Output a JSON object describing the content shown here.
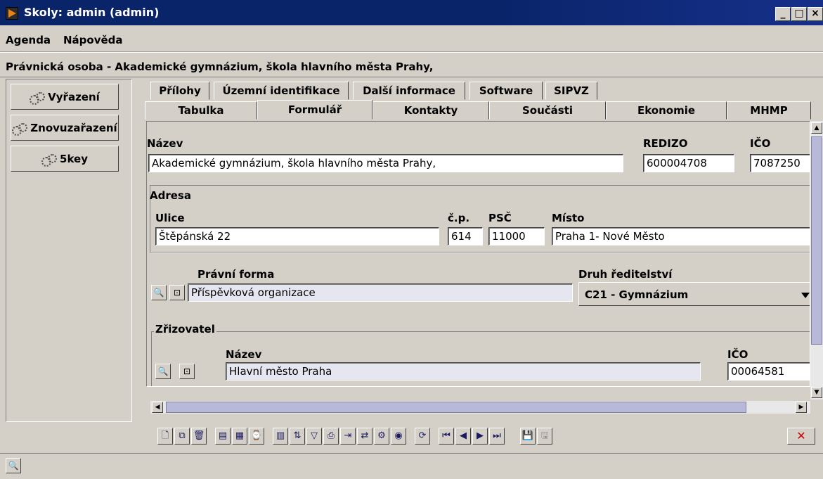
{
  "window": {
    "title": "Skoly: admin (admin)"
  },
  "menu": {
    "items": [
      "Agenda",
      "Nápověda"
    ]
  },
  "subject": {
    "text": "Právnická osoba - Akademické gymnázium, škola hlavního města Prahy,"
  },
  "left_buttons": [
    "Vyřazení",
    "Znovuzařazení",
    "5key"
  ],
  "tabs_top": [
    "Přílohy",
    "Územní identifikace",
    "Další informace",
    "Software",
    "SIPVZ"
  ],
  "tabs_bottom": [
    "Tabulka",
    "Formulář",
    "Kontakty",
    "Součásti",
    "Ekonomie",
    "MHMP"
  ],
  "active_tab": "Formulář",
  "form": {
    "nazev_label": "Název",
    "nazev_value": "Akademické gymnázium, škola hlavního města Prahy,",
    "redizo_label": "REDIZO",
    "redizo_value": "600004708",
    "ico_label": "IČO",
    "ico_value": "7087250",
    "adresa_legend": "Adresa",
    "ulice_label": "Ulice",
    "ulice_value": "Štěpánská 22",
    "cp_label": "č.p.",
    "cp_value": "614",
    "psc_label": "PSČ",
    "psc_value": "11000",
    "misto_label": "Místo",
    "misto_value": "Praha 1- Nové Město",
    "pravni_forma_label": "Právní forma",
    "pravni_forma_value": "Příspěvková organizace",
    "druh_label": "Druh ředitelství",
    "druh_value": "C21 - Gymnázium",
    "zrizovatel_legend": "Zřizovatel",
    "zr_nazev_label": "Název",
    "zr_nazev_value": "Hlavní město Praha",
    "zr_ico_label": "IČO",
    "zr_ico_value": "00064581"
  },
  "close_glyph": "✕",
  "colors": {
    "titlebar": "#0a246a",
    "close": "#cc0000",
    "readonly_field": "#e6e6f0"
  }
}
